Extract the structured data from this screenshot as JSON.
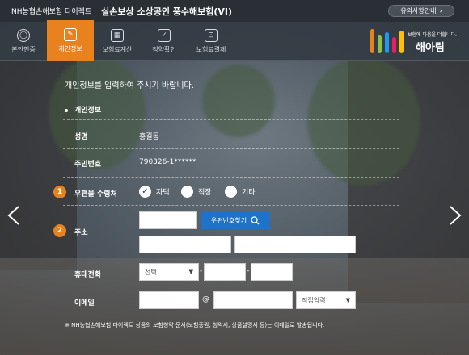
{
  "header": {
    "brand": "NH농협손해보험 다이렉트",
    "title": "실손보상 소상공인 풍수해보험(VI)",
    "notice_button": "유의사항안내",
    "notice_chevron": "›"
  },
  "nav": {
    "steps": [
      {
        "label": "본인인증",
        "icon": "person-icon",
        "glyph": "◯",
        "active": false
      },
      {
        "label": "개인정보",
        "icon": "edit-icon",
        "glyph": "✎",
        "active": true
      },
      {
        "label": "보험료계산",
        "icon": "calculator-icon",
        "glyph": "▦",
        "active": false
      },
      {
        "label": "청약확인",
        "icon": "check-icon",
        "glyph": "✓",
        "active": false
      },
      {
        "label": "보험료결제",
        "icon": "payment-icon",
        "glyph": "⊡",
        "active": false
      }
    ],
    "logo": {
      "slogan": "보험에 마음을 더합니다.",
      "name": "해아림",
      "bar_colors": [
        "#e8821e",
        "#8bc34a",
        "#2196f3",
        "#e91e63",
        "#ffc107"
      ]
    }
  },
  "form": {
    "intro": "개인정보를 입력하여 주시기 바랍니다.",
    "section_title": "개인정보",
    "name_label": "성명",
    "name_value": "홍길동",
    "ssn_label": "주민번호",
    "ssn_value": "790326-1******",
    "mail_label": "우편물 수령처",
    "mail_badge": "1",
    "mail_options": [
      {
        "label": "자택",
        "checked": true
      },
      {
        "label": "직장",
        "checked": false
      },
      {
        "label": "기타",
        "checked": false
      }
    ],
    "address_label": "주소",
    "address_badge": "2",
    "zip_button": "우편번호찾기",
    "phone_label": "휴대전화",
    "phone_select": "선택",
    "phone_dash": "-",
    "email_label": "이메일",
    "email_at": "@",
    "email_domain_select": "직접입력",
    "footnote": "※ NH농협손해보험 다이렉트 상품의 보험청약 문서(보험증권, 청약서, 상품설명서 등)는 이메일로 발송됩니다."
  },
  "colors": {
    "accent": "#e8821e",
    "zip_button": "#1e73c9",
    "topbar": "#2a2f36"
  }
}
